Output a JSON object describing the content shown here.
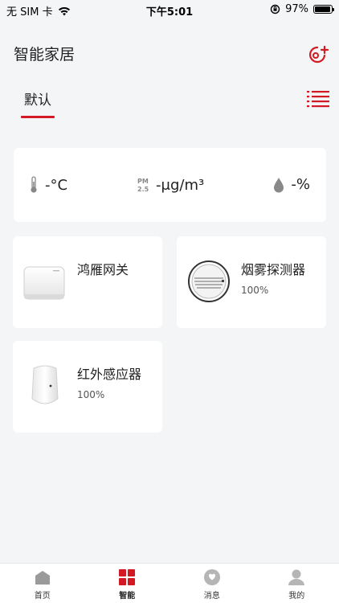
{
  "status_bar": {
    "carrier": "无 SIM 卡",
    "time": "下午5:01",
    "battery": "97%",
    "battery_level": 0.97
  },
  "header": {
    "title": "智能家居",
    "add_home_icon": "add-home-icon"
  },
  "tabs": [
    {
      "label": "默认",
      "active": true
    }
  ],
  "environment": {
    "temperature": "-°C",
    "pm25": "-μg/m³",
    "pm25_icon_label": "PM 2.5",
    "humidity": "-%"
  },
  "devices": [
    {
      "name": "鸿雁网关",
      "status": ""
    },
    {
      "name": "烟雾探测器",
      "status": "100%"
    },
    {
      "name": "红外感应器",
      "status": "100%"
    }
  ],
  "tabbar": [
    {
      "label": "首页",
      "icon": "home-icon"
    },
    {
      "label": "智能",
      "icon": "smart-grid-icon",
      "active": true
    },
    {
      "label": "消息",
      "icon": "message-icon"
    },
    {
      "label": "我的",
      "icon": "profile-icon"
    }
  ],
  "colors": {
    "accent": "#d31a24",
    "background": "#f4f5f7",
    "card": "#ffffff"
  }
}
